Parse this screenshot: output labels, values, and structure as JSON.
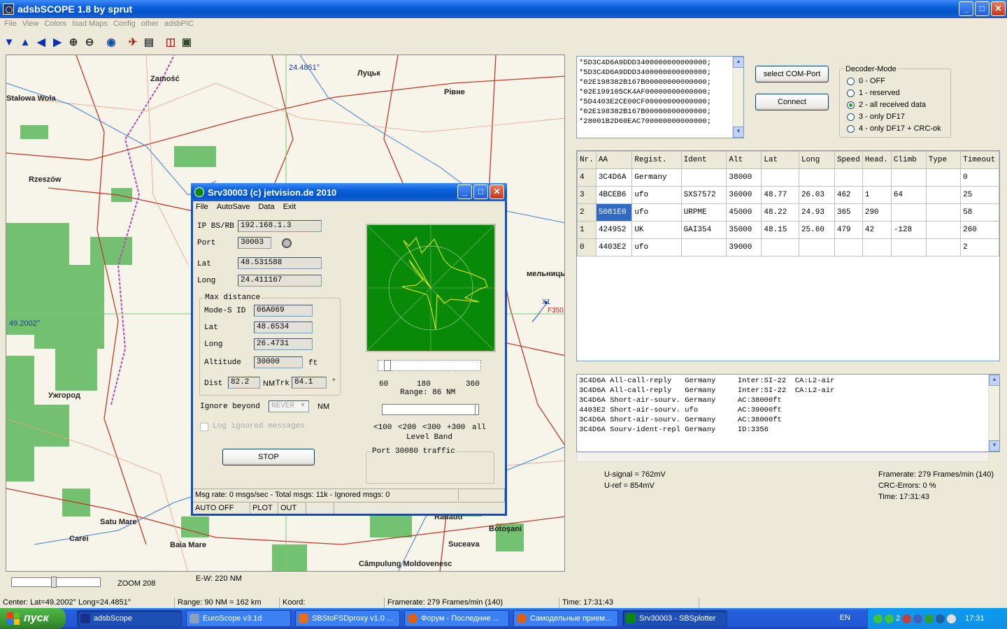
{
  "app": {
    "title": "adsbSCOPE 1.8  by sprut"
  },
  "menu": [
    "File",
    "View",
    "Colors",
    "load Maps",
    "Config",
    "other",
    "adsbPIC"
  ],
  "toolbar": {
    "icons": [
      "arrow-down-icon",
      "arrow-up-icon",
      "arrow-left-icon",
      "arrow-right-icon",
      "zoom-in-icon",
      "zoom-out-icon",
      "globe-icon",
      "aircraft-icon",
      "print-icon",
      "chart-icon",
      "monitor-icon"
    ]
  },
  "map": {
    "labels": [
      "Zamość",
      "Rzeszów",
      "Луцьк",
      "Рівне",
      "Ужгород",
      "Satu Mare",
      "Carei",
      "Baia Mare",
      "Suceava",
      "Botoşani",
      "Câmpulung Moldovenesc",
      "Radauti",
      "Stalowa Wola",
      "мельницький"
    ],
    "coord_top": "24.4851°",
    "coord_left": "49.2002°",
    "aircraft_label": "X1",
    "aircraft_alt": "F350",
    "zoom": "ZOOM 208",
    "ew": "E-W: 220 NM"
  },
  "statusbar": {
    "center": "Center: Lat=49.2002° Long=24.4851°",
    "range": "Range: 90 NM = 162 km",
    "koord": "Koord:",
    "framerate": "Framerate:  279 Frames/min (140)",
    "time": "Time: 17:31:43"
  },
  "raw": [
    "*5D3C4D6A9DDD3400000000000000;",
    "*5D3C4D6A9DDD3400000000000000;",
    "*02E198382B167B00000000000000;",
    "*02E199105CK4AF00000000000000;",
    "*5D4403E2CE00CF00000000000000;",
    "*02E198382B167B00000000000000;",
    "*28001B2D60EAC700000000000000;"
  ],
  "buttons": {
    "select_com": "select COM-Port",
    "connect": "Connect"
  },
  "decoder": {
    "title": "Decoder-Mode",
    "options": [
      "0 - OFF",
      "1 - reserved",
      "2 - all received data",
      "3 - only DF17",
      "4 - only DF17 + CRC-ok"
    ],
    "selected": 2
  },
  "table": {
    "headers": [
      "Nr.",
      "AA",
      "Regist.",
      "Ident",
      "Alt",
      "Lat",
      "Long",
      "Speed",
      "Head.",
      "Climb",
      "Type",
      "Timeout"
    ],
    "rows": [
      [
        "4",
        "3C4D6A",
        "Germany",
        "",
        "38000",
        "",
        "",
        "",
        "",
        "",
        "",
        "0"
      ],
      [
        "3",
        "4BCEB6",
        "ufo",
        "SXS7572",
        "36000",
        "48.77",
        "26.03",
        "462",
        "1",
        "64",
        "",
        "25"
      ],
      [
        "2",
        "5081E0",
        "ufo",
        "URPME",
        "45000",
        "48.22",
        "24.93",
        "365",
        "290",
        "",
        "",
        "58"
      ],
      [
        "1",
        "424952",
        "UK",
        "GAI354",
        "35000",
        "48.15",
        "25.60",
        "479",
        "42",
        "-128",
        "",
        "260"
      ],
      [
        "0",
        "4403E2",
        "ufo",
        "",
        "39000",
        "",
        "",
        "",
        "",
        "",
        "",
        "2"
      ]
    ]
  },
  "log": [
    "3C4D6A All-call-reply   Germany     Inter:SI-22  CA:L2-air",
    "3C4D6A All-call-reply   Germany     Inter:SI-22  CA:L2-air",
    "3C4D6A Short-air-sourv. Germany     AC:38000ft",
    "4403E2 Short-air-sourv. ufo         AC:39000ft",
    "3C4D6A Short-air-sourv. Germany     AC:38000ft",
    "3C4D6A Sourv-ident-repl Germany     ID:3356"
  ],
  "signal": {
    "u_signal": "U-signal = 762mV",
    "u_ref": "U-ref = 854mV"
  },
  "frameinfo": {
    "framerate": "Framerate:  279 Frames/min (140)",
    "crc": "CRC-Errors: 0 %",
    "time": "Time: 17:31:43"
  },
  "srv": {
    "title": "Srv30003 (c) jetvision.de 2010",
    "menu": [
      "File",
      "AutoSave",
      "Data",
      "Exit"
    ],
    "ip_label": "IP BS/RB",
    "ip": "192.168.1.3",
    "port_label": "Port",
    "port": "30003",
    "lat_label": "Lat",
    "lat": "48.531588",
    "long_label": "Long",
    "long": "24.411167",
    "max_distance": "Max distance",
    "modes_label": "Mode-S ID",
    "modes": "06A069",
    "mlat_label": "Lat",
    "mlat": "48.6534",
    "mlong_label": "Long",
    "mlong": "26.4731",
    "alt_label": "Altitude",
    "alt": "30000",
    "alt_unit": "ft",
    "dist_label": "Dist",
    "dist": "82.2",
    "nm": "NM",
    "trk_label": "Trk",
    "trk": "84.1",
    "deg": "°",
    "ignore_label": "Ignore beyond",
    "ignore_value": "NEVER",
    "ignore_unit": "NM",
    "log_ignored": "Log ignored messages",
    "stop": "STOP",
    "range_ticks": [
      "60",
      "180",
      "360"
    ],
    "range": "Range: 86 NM",
    "level_ticks": [
      "<100",
      "<200",
      "<300",
      "+300",
      "all"
    ],
    "level_band": "Level Band",
    "port_traffic": "Port 30080 traffic",
    "msg_rate": "Msg rate: 0 msgs/sec - Total msgs: 11k - Ignored msgs: 0",
    "status2": [
      "AUTO OFF",
      "PLOT",
      "OUT"
    ]
  },
  "taskbar": {
    "start": "пуск",
    "tasks": [
      "adsbScope",
      "EuroScope v3.1d",
      "SBStoFSDproxy v1.0 ...",
      "Форум - Последние ...",
      "Самодельные прием...",
      "Srv30003 - SBSplotter"
    ],
    "lang": "EN",
    "tray_count": "2",
    "clock": "17:31"
  }
}
